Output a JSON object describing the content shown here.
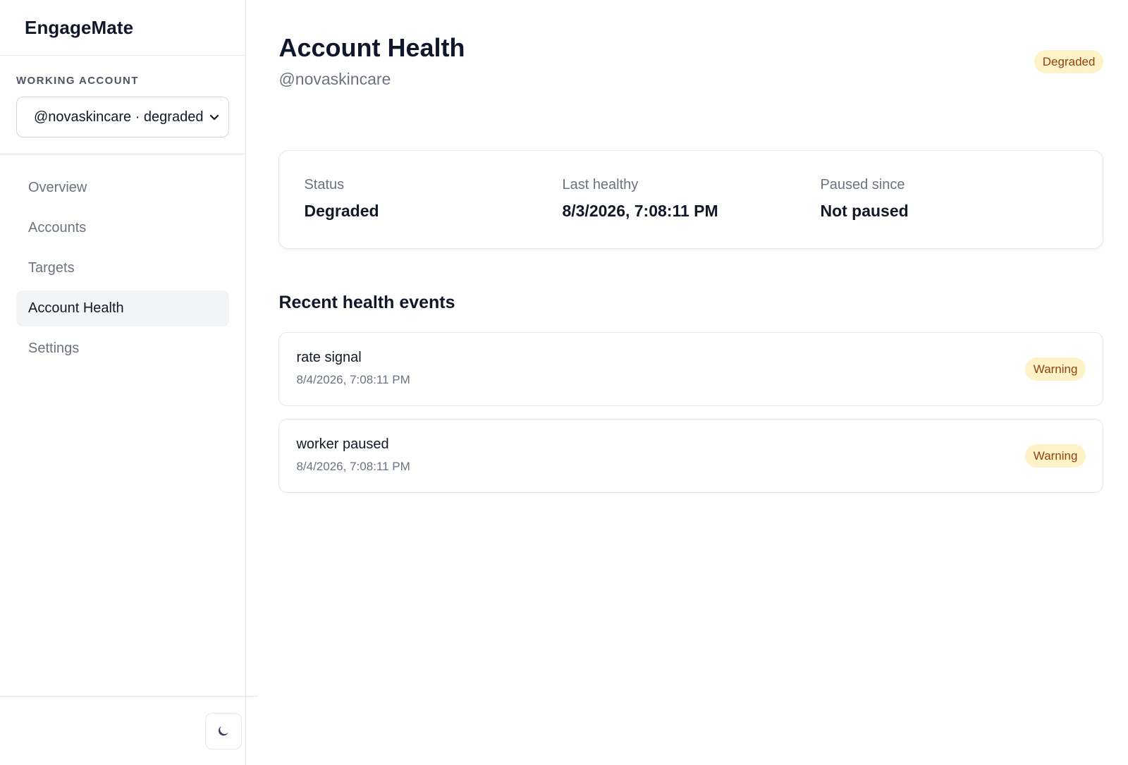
{
  "brand": "EngageMate",
  "sidebar": {
    "account_label": "WORKING ACCOUNT",
    "account_select_value": "@novaskincare · degraded",
    "nav": [
      {
        "label": "Overview"
      },
      {
        "label": "Accounts"
      },
      {
        "label": "Targets"
      },
      {
        "label": "Account Health"
      },
      {
        "label": "Settings"
      }
    ],
    "active_nav": "Account Health",
    "theme_toggle_icon": "moon-icon"
  },
  "header": {
    "title": "Account Health",
    "handle": "@novaskincare",
    "status_badge": "Degraded"
  },
  "status_card": {
    "stats": [
      {
        "label": "Status",
        "value": "Degraded"
      },
      {
        "label": "Last healthy",
        "value": "8/3/2026, 7:08:11 PM"
      },
      {
        "label": "Paused since",
        "value": "Not paused"
      }
    ]
  },
  "events_section": {
    "title": "Recent health events",
    "events": [
      {
        "title": "rate signal",
        "time": "8/4/2026, 7:08:11 PM",
        "severity": "Warning"
      },
      {
        "title": "worker paused",
        "time": "8/4/2026, 7:08:11 PM",
        "severity": "Warning"
      }
    ]
  },
  "colors": {
    "warning_bg": "#fef3c7",
    "warning_text": "#92400e",
    "active_nav_bg": "#f3f4f6"
  }
}
